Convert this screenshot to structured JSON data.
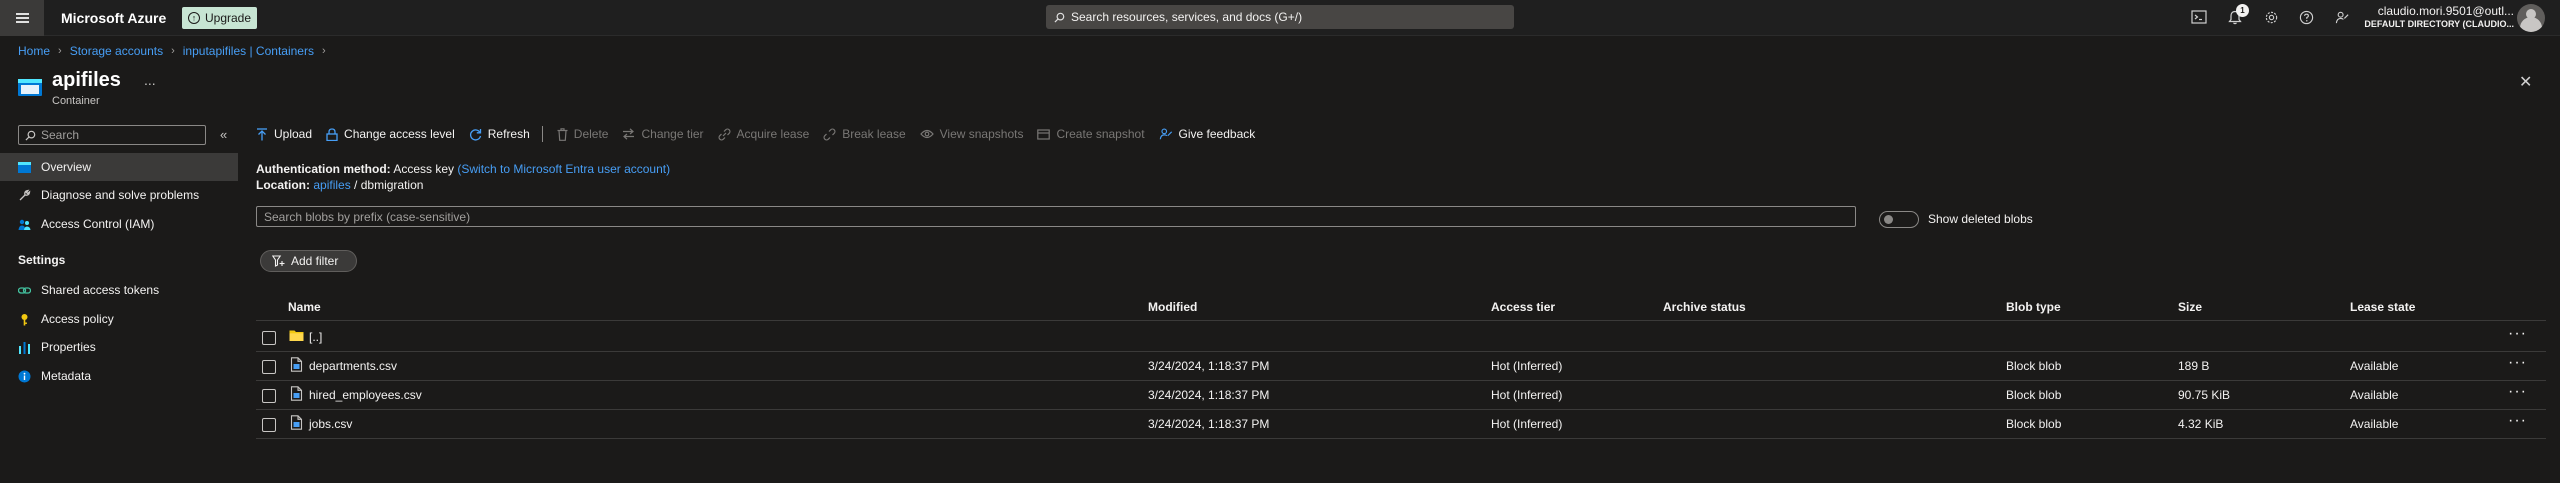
{
  "topbar": {
    "brand": "Microsoft Azure",
    "upgrade_label": "Upgrade",
    "search_placeholder": "Search resources, services, and docs (G+/)",
    "notification_count": "1",
    "user_name": "claudio.mori.9501@outl...",
    "user_directory": "DEFAULT DIRECTORY (CLAUDIO..."
  },
  "breadcrumb": [
    "Home",
    "Storage accounts",
    "inputapifiles | Containers"
  ],
  "header": {
    "title": "apifiles",
    "subtitle": "Container",
    "more": "...",
    "close": "✕"
  },
  "nav": {
    "search_placeholder": "Search",
    "collapse": "«",
    "items": [
      {
        "label": "Overview",
        "icon": "container-icon"
      },
      {
        "label": "Diagnose and solve problems",
        "icon": "wrench-icon"
      },
      {
        "label": "Access Control (IAM)",
        "icon": "people-icon"
      }
    ],
    "settings_heading": "Settings",
    "settings_items": [
      {
        "label": "Shared access tokens",
        "icon": "link-icon"
      },
      {
        "label": "Access policy",
        "icon": "key-icon"
      },
      {
        "label": "Properties",
        "icon": "properties-icon"
      },
      {
        "label": "Metadata",
        "icon": "info-icon"
      }
    ]
  },
  "toolbar": {
    "upload": "Upload",
    "change_access": "Change access level",
    "refresh": "Refresh",
    "delete": "Delete",
    "change_tier": "Change tier",
    "acquire_lease": "Acquire lease",
    "break_lease": "Break lease",
    "view_snapshots": "View snapshots",
    "create_snapshot": "Create snapshot",
    "feedback": "Give feedback"
  },
  "info": {
    "auth_label": "Authentication method:",
    "auth_value": "Access key",
    "auth_link": "(Switch to Microsoft Entra user account)",
    "location_label": "Location:",
    "location_link": "apifiles",
    "location_sep": "/",
    "location_folder": "dbmigration"
  },
  "blob_search_placeholder": "Search blobs by prefix (case-sensitive)",
  "show_deleted": "Show deleted blobs",
  "add_filter": "Add filter",
  "table": {
    "headers": {
      "name": "Name",
      "modified": "Modified",
      "tier": "Access tier",
      "archive": "Archive status",
      "type": "Blob type",
      "size": "Size",
      "lease": "Lease state"
    },
    "rows": [
      {
        "name": "[..]",
        "kind": "folder",
        "modified": "",
        "tier": "",
        "archive": "",
        "type": "",
        "size": "",
        "lease": ""
      },
      {
        "name": "departments.csv",
        "kind": "file",
        "modified": "3/24/2024, 1:18:37 PM",
        "tier": "Hot (Inferred)",
        "archive": "",
        "type": "Block blob",
        "size": "189 B",
        "lease": "Available"
      },
      {
        "name": "hired_employees.csv",
        "kind": "file",
        "modified": "3/24/2024, 1:18:37 PM",
        "tier": "Hot (Inferred)",
        "archive": "",
        "type": "Block blob",
        "size": "90.75 KiB",
        "lease": "Available"
      },
      {
        "name": "jobs.csv",
        "kind": "file",
        "modified": "3/24/2024, 1:18:37 PM",
        "tier": "Hot (Inferred)",
        "archive": "",
        "type": "Block blob",
        "size": "4.32 KiB",
        "lease": "Available"
      }
    ],
    "more": "···"
  },
  "colors": {
    "background": "#1b1a19",
    "link": "#479ef5",
    "upgrade_bg": "#c7e5d3",
    "folder": "#f2c811"
  }
}
